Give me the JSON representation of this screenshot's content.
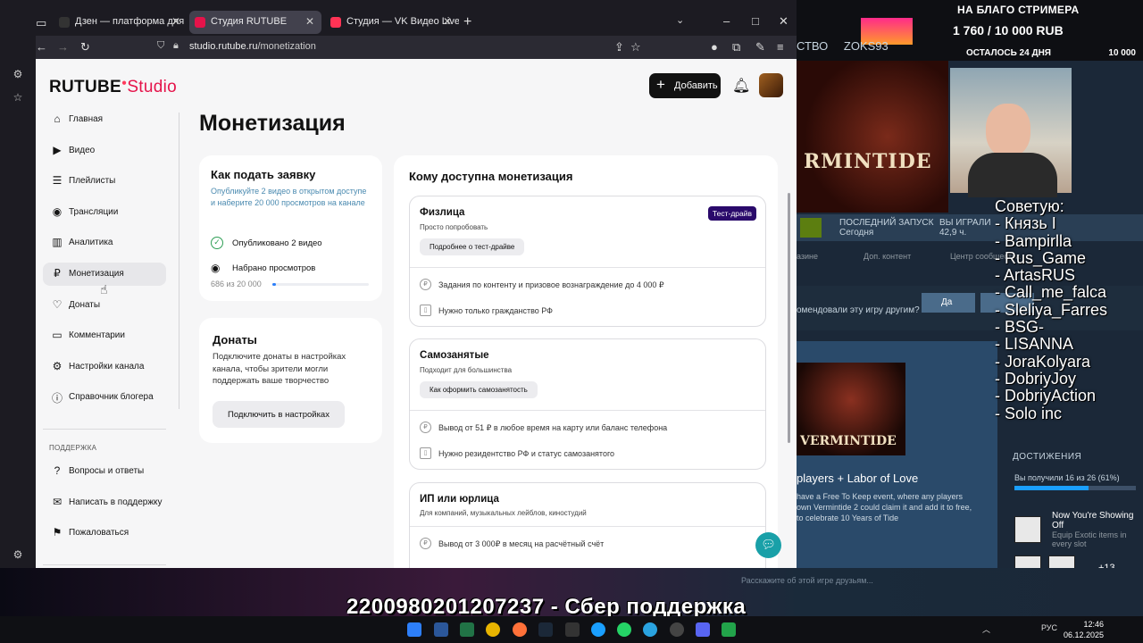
{
  "browser": {
    "tabs": [
      {
        "label": "Дзен — платформа для просм",
        "active": false,
        "color": "#333333"
      },
      {
        "label": "Студия RUTUBE",
        "active": true,
        "color": "#e5134a"
      },
      {
        "label": "Студия — VK Видео Live",
        "active": false,
        "color": "#ff3355"
      }
    ],
    "url_host": "studio.rutube.ru",
    "url_path": "/monetization"
  },
  "header": {
    "logo_main": "RUTUBE",
    "logo_studio": "Studio",
    "add_label": "Добавить"
  },
  "nav": {
    "items": [
      {
        "label": "Главная",
        "icon": "home-icon"
      },
      {
        "label": "Видео",
        "icon": "video-icon"
      },
      {
        "label": "Плейлисты",
        "icon": "playlist-icon"
      },
      {
        "label": "Трансляции",
        "icon": "broadcast-icon"
      },
      {
        "label": "Аналитика",
        "icon": "analytics-icon"
      },
      {
        "label": "Монетизация",
        "icon": "ruble-icon",
        "active": true
      },
      {
        "label": "Донаты",
        "icon": "donate-icon"
      },
      {
        "label": "Комментарии",
        "icon": "comments-icon"
      },
      {
        "label": "Настройки канала",
        "icon": "settings-icon"
      },
      {
        "label": "Справочник блогера",
        "icon": "info-icon"
      }
    ],
    "support_title": "ПОДДЕРЖКА",
    "support_items": [
      {
        "label": "Вопросы и ответы",
        "icon": "faq-icon"
      },
      {
        "label": "Написать в поддержку",
        "icon": "mail-icon"
      },
      {
        "label": "Пожаловаться",
        "icon": "flag-icon"
      }
    ]
  },
  "main": {
    "title": "Монетизация",
    "apply": {
      "title": "Как подать заявку",
      "desc": "Опубликуйте 2 видео в открытом доступе и наберите 20 000 просмотров на канале",
      "published": "Опубликовано 2 видео",
      "views": "Набрано просмотров",
      "views_progress": "686 из 20 000",
      "views_fraction": 0.0343
    },
    "donates": {
      "title": "Донаты",
      "desc": "Подключите донаты в настройках канала, чтобы зрители могли поддержать ваше творчество",
      "button": "Подключить в настройках"
    },
    "who": {
      "title": "Кому доступна монетизация",
      "tiers": [
        {
          "title": "Физлица",
          "subtitle": "Просто попробовать",
          "button": "Подробнее о тест-драйве",
          "badge": "Тест-драйв",
          "rows": [
            "Задания по контенту и призовое вознаграждение до 4 000 ₽",
            "Нужно только гражданство РФ"
          ]
        },
        {
          "title": "Самозанятые",
          "subtitle": "Подходит для большинства",
          "button": "Как оформить самозанятость",
          "rows": [
            "Вывод от 51 ₽ в любое время на карту или баланс телефона",
            "Нужно резидентство РФ и статус самозанятого"
          ]
        },
        {
          "title": "ИП или юрлица",
          "subtitle": "Для компаний, музыкальных лейблов, киностудий",
          "rows": [
            "Вывод от 3 000₽ в месяц на расчётный счёт"
          ]
        }
      ]
    }
  },
  "stream": {
    "donate_title": "НА БЛАГО СТРИМЕРА",
    "donate_amount": "1 760 / 10 000 RUB",
    "donate_left": "ОСТАЛОСЬ 24 ДНЯ",
    "donate_goal": "10 000",
    "steam_tabs": [
      "СТВО",
      "ZOKS93"
    ],
    "game_title": "RMINTIDE",
    "last_launch": "ПОСЛЕДНИЙ ЗАПУСК",
    "last_launch_val": "Сегодня",
    "played": "ВЫ ИГРАЛИ",
    "played_val": "42,9 ч.",
    "row_labels": [
      "азине",
      "Доп. контент",
      "Центр сообщества"
    ],
    "recommend": "омендовали эту игру другим?",
    "yes": "Да",
    "chat": [
      "Советую:",
      "- Князь I",
      "- Bampirlla",
      "- Rus_Game",
      "- ArtasRUS",
      "- Call_me_falca",
      "- Sleliya_Farres",
      "- BSG-",
      "- LISANNA",
      "- JoraKolyara",
      "- DobriyJoy",
      "- DobriyAction",
      "- Solo inc"
    ],
    "news_art": "VERMINTIDE",
    "news_title": "players + Labor of Love",
    "news_text": "have a Free To Keep event, where any players own Vermintide 2 could claim it and add it to free, to celebrate 10 Years of Tide",
    "achv_title": "ДОСТИЖЕНИЯ",
    "achv_got": "Вы получили 16 из 26 (61%)",
    "achv_fraction": 0.61,
    "achv_name": "Now You're Showing Off",
    "achv_desc": "Equip Exotic items in every slot",
    "achv_more": "+13",
    "friends_note": "Расскажите об этой игре друзьям...",
    "banner": "2200980201207237 - Сбер поддержка"
  },
  "taskbar": {
    "lang": "РУС",
    "time": "12:46",
    "date": "06.12.2025"
  }
}
